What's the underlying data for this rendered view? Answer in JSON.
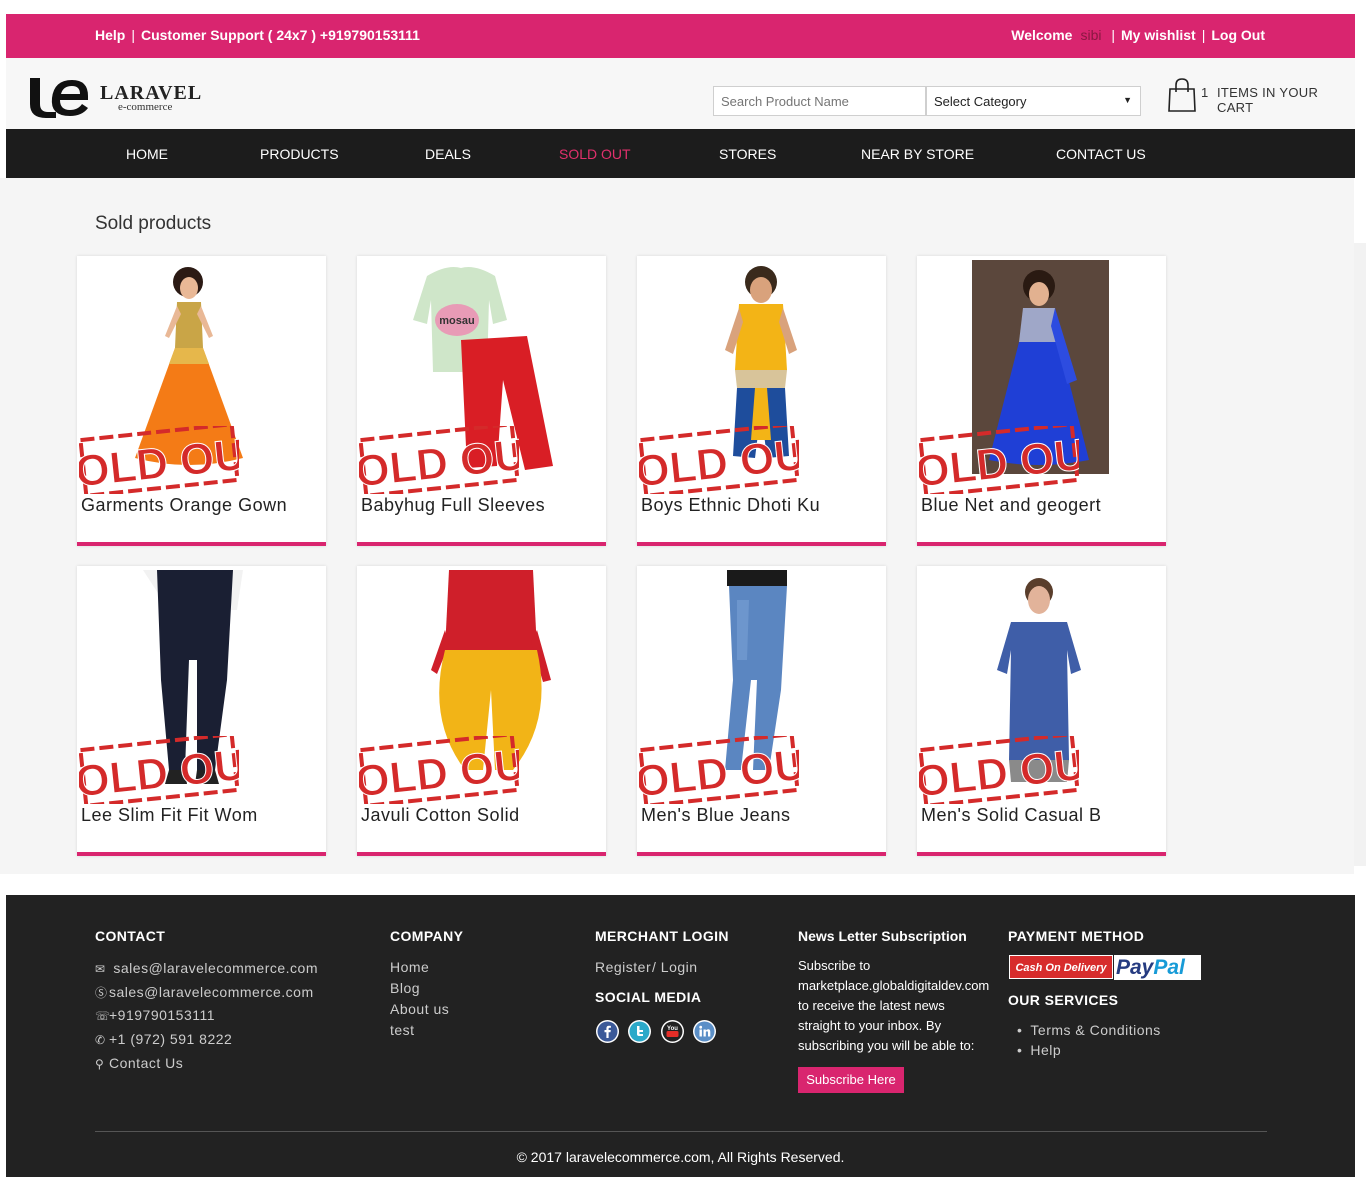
{
  "topbar": {
    "help": "Help",
    "support": "Customer Support ( 24x7 ) +919790153111",
    "welcome": "Welcome",
    "user": "sibi",
    "wishlist": "My wishlist",
    "logout": "Log Out"
  },
  "header": {
    "logo_text": "LARAVEL",
    "logo_sub": "e-commerce",
    "search_placeholder": "Search Product Name",
    "category_selected": "Select Category",
    "cart_count": "1",
    "cart_label": "ITEMS IN YOUR CART"
  },
  "nav": {
    "home": "HOME",
    "products": "PRODUCTS",
    "deals": "DEALS",
    "sold_out": "SOLD OUT",
    "stores": "STORES",
    "near_by_store": "NEAR BY STORE",
    "contact_us": "CONTACT US"
  },
  "main": {
    "title": "Sold products",
    "stamp_text": "SOLD OUT",
    "products": [
      {
        "name": "Garments Orange Gown"
      },
      {
        "name": "Babyhug Full Sleeves"
      },
      {
        "name": "Boys Ethnic Dhoti Ku"
      },
      {
        "name": "Blue Net and geogert"
      },
      {
        "name": "Lee Slim Fit Fit Wom"
      },
      {
        "name": "Javuli Cotton Solid"
      },
      {
        "name": "Men's Blue Jeans"
      },
      {
        "name": "Men's Solid Casual B"
      }
    ]
  },
  "footer": {
    "contact": {
      "heading": "CONTACT",
      "email": "sales@laravelecommerce.com",
      "skype": "sales@laravelecommerce.com",
      "whatsapp": "+919790153111",
      "phone": "+1 (972) 591 8222",
      "contact_link": "Contact Us"
    },
    "company": {
      "heading": "COMPANY",
      "links": [
        "Home",
        "Blog",
        "About us",
        "test"
      ]
    },
    "merchant": {
      "heading": "MERCHANT LOGIN",
      "register": "Register",
      "login": "/ Login"
    },
    "social": {
      "heading": "SOCIAL MEDIA",
      "icons": [
        "facebook-icon",
        "twitter-icon",
        "youtube-icon",
        "linkedin-icon"
      ]
    },
    "newsletter": {
      "heading": "News Letter Subscription",
      "lines": [
        "Subscribe to",
        "marketplace.globaldigitaldev.com",
        "to receive the latest news",
        "straight to your inbox. By",
        "subscribing you will be able to:"
      ],
      "button": "Subscribe Here"
    },
    "payment": {
      "heading": "PAYMENT METHOD",
      "cod": "Cash On Delivery",
      "paypal_a": "Pay",
      "paypal_b": "Pal"
    },
    "services": {
      "heading": "OUR SERVICES",
      "items": [
        "Terms & Conditions",
        "Help"
      ]
    },
    "copyright": "© 2017 laravelecommerce.com, All Rights Reserved."
  },
  "colors": {
    "accent": "#d9256f",
    "nav_bg": "#1c1c1c",
    "footer_bg": "#222222",
    "stamp": "#d42a2a"
  }
}
